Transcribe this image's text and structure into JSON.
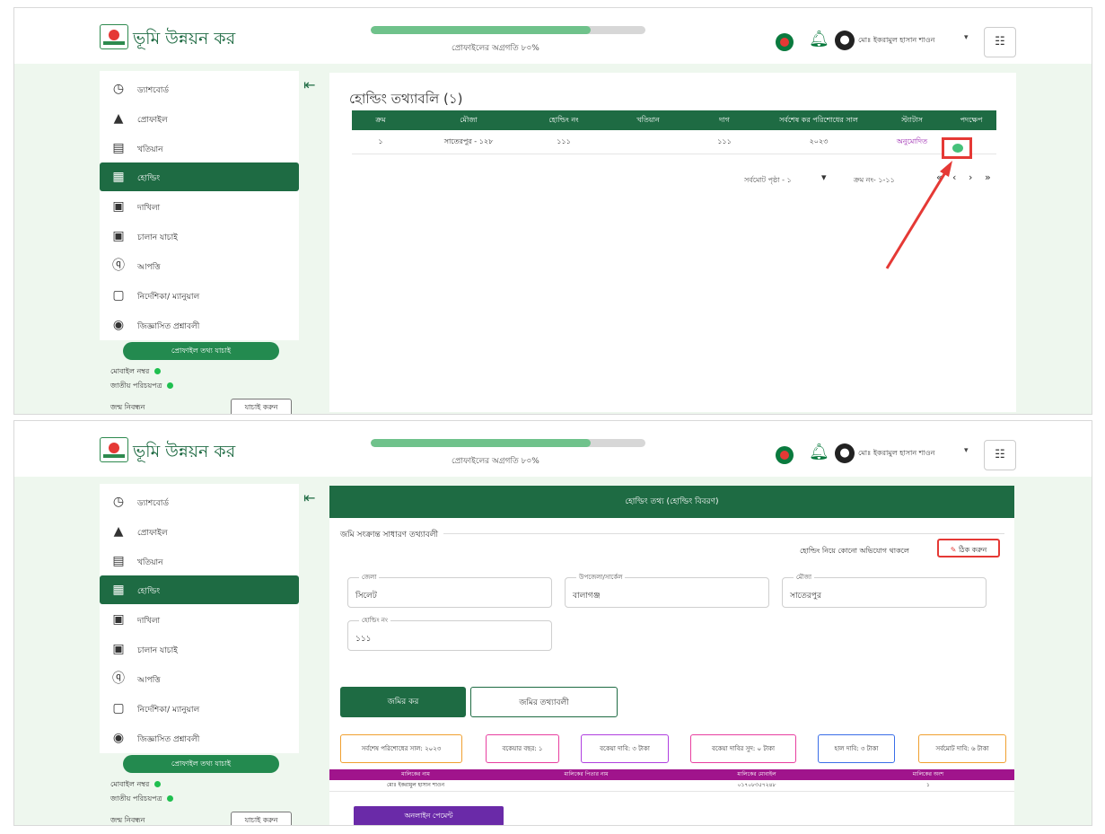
{
  "header": {
    "app_title": "ভূমি উন্নয়ন কর",
    "progress_label": "প্রোফাইলের অগ্রগতি ৮০%",
    "progress_fraction": 0.8,
    "user_name": "মোঃ ইকরামুল হাসান শাওন",
    "grid_icon": "apps-grid-icon"
  },
  "sidebar": {
    "items": [
      {
        "label": "ড্যাশবোর্ড",
        "icon": "dashboard-icon"
      },
      {
        "label": "প্রোফাইল",
        "icon": "user-icon"
      },
      {
        "label": "খতিয়ান",
        "icon": "document-icon"
      },
      {
        "label": "হোল্ডিং",
        "icon": "holding-icon"
      },
      {
        "label": "দাখিলা",
        "icon": "receipt-icon"
      },
      {
        "label": "চালান যাচাই",
        "icon": "verify-icon"
      },
      {
        "label": "আপত্তি",
        "icon": "objection-icon"
      },
      {
        "label": "নির্দেশিকা/ ম্যানুয়াল",
        "icon": "manual-icon"
      },
      {
        "label": "জিজ্ঞাসিত প্রশ্নাবলী",
        "icon": "faq-icon"
      }
    ],
    "active_index": 3,
    "cta_label": "প্রোফাইল তথ্য যাচাই",
    "mobile_label": "মোবাইল নম্বর",
    "nid_label": "জাতীয় পরিচয়পত্র",
    "dob_label": "জন্ম নিবন্ধন",
    "change_label": "যাচাই করুন",
    "collapse_icon": "menu-collapse-icon"
  },
  "screen1": {
    "title": "হোল্ডিং তথ্যাবলি (১)",
    "table_headers": [
      "ক্রম",
      "মৌজা",
      "হোল্ডিং নং",
      "খতিয়ান",
      "দাগ",
      "সর্বশেষ কর পরিশোধের সাল",
      "স্ট্যাটাস",
      "পদক্ষেপ"
    ],
    "rows": [
      [
        "১",
        "সাতেরপুর - ১২৮",
        "১১১",
        "",
        "১১১",
        "২০২৩",
        "অনুমোদিত",
        ""
      ]
    ],
    "pager_rows": "সর্বমোট পৃষ্ঠা - ১",
    "pager_range": "ক্রম নং- ১-১১",
    "view_icon": "eye-icon"
  },
  "screen2": {
    "header": "হোল্ডিং তথ্য (হোল্ডিং বিবরণ)",
    "section_title": "জমি সংক্রান্ত সাধারণ তথ্যাবলী",
    "fix_note": "হোল্ডিং নিয়ে কোনো অভিযোগ থাকলে",
    "fix_button": "ঠিক করুন",
    "fields": [
      {
        "label": "জেলা",
        "value": "সিলেট"
      },
      {
        "label": "উপজেলা/সার্কেল",
        "value": "বালাগঞ্জ"
      },
      {
        "label": "মৌজা",
        "value": "সাতেরপুর"
      },
      {
        "label": "হোল্ডিং নং",
        "value": "১১১"
      }
    ],
    "tab_active": "জমির কর",
    "tab_other": "জমির তথ্যাবলী",
    "chips": [
      {
        "label": "সর্বশেষ পরিশোধের সাল: ২০২৩",
        "color": "#f0a030"
      },
      {
        "label": "বকেয়ার বছর: ১",
        "color": "#e83fa0"
      },
      {
        "label": "বকেয়া দাবি: ৩ টাকা",
        "color": "#b040e0"
      },
      {
        "label": "বকেয়া দাবির সুদ: ০ টাকা",
        "color": "#e83fa0"
      },
      {
        "label": "হাল দাবি: ৩ টাকা",
        "color": "#3a6ee8"
      },
      {
        "label": "সর্বমোট দাবি: ৬ টাকা",
        "color": "#f0a030"
      }
    ],
    "summary_headers": [
      "মালিকের নাম",
      "মালিকের পিতার নাম",
      "মালিকের মোবাইল",
      "মালিকের অংশ"
    ],
    "summary_row": [
      "মোঃ ইকরামুল হাসান শাওন",
      "",
      "০১৭০৮৩৫৭২৪৮",
      "১"
    ],
    "pay_button": "অনলাইন পেমেন্ট"
  },
  "colors": {
    "brand_green": "#1e6b43",
    "accent_red": "#e53935",
    "summary_purple": "#a0148c",
    "pay_purple": "#6a2aa8"
  }
}
